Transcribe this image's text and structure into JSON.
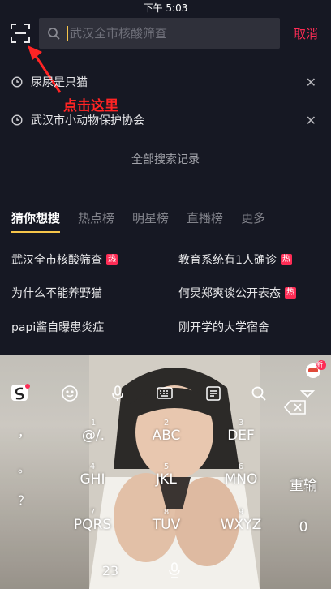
{
  "status_bar": {
    "time": "下午 5:03"
  },
  "search": {
    "placeholder": "武汉全市核酸筛查",
    "cancel_label": "取消"
  },
  "history": [
    {
      "text": "尿尿是只猫"
    },
    {
      "text": "武汉市小动物保护协会"
    }
  ],
  "annotation": {
    "text": "点击这里"
  },
  "all_history_label": "全部搜索记录",
  "tabs": [
    "猜你想搜",
    "热点榜",
    "明星榜",
    "直播榜",
    "更多"
  ],
  "trends": [
    {
      "text": "武汉全市核酸筛查",
      "badge": "热"
    },
    {
      "text": "教育系统有1人确诊",
      "badge": "热"
    },
    {
      "text": "为什么不能养野猫",
      "badge": ""
    },
    {
      "text": "何炅郑爽谈公开表态",
      "badge": "热"
    },
    {
      "text": "papi酱自曝患炎症",
      "badge": ""
    },
    {
      "text": "刚开学的大学宿舍",
      "badge": ""
    }
  ],
  "keyboard": {
    "new_badge": "新",
    "side_keys": [
      "，",
      "。",
      "？"
    ],
    "keys": [
      {
        "num": "1",
        "label": "@/."
      },
      {
        "num": "2",
        "label": "ABC"
      },
      {
        "num": "3",
        "label": "DEF"
      },
      {
        "num": "4",
        "label": "GHI"
      },
      {
        "num": "5",
        "label": "JKL"
      },
      {
        "num": "6",
        "label": "MNO"
      },
      {
        "num": "7",
        "label": "PQRS"
      },
      {
        "num": "8",
        "label": "TUV"
      },
      {
        "num": "9",
        "label": "WXYZ"
      }
    ],
    "enter_label": "重输",
    "zero_label": "0",
    "num_switch_label": "23"
  },
  "colors": {
    "accent": "#fe2c55",
    "cursor": "#f6c54a",
    "background": "#161823",
    "annotation": "#ff2424"
  }
}
